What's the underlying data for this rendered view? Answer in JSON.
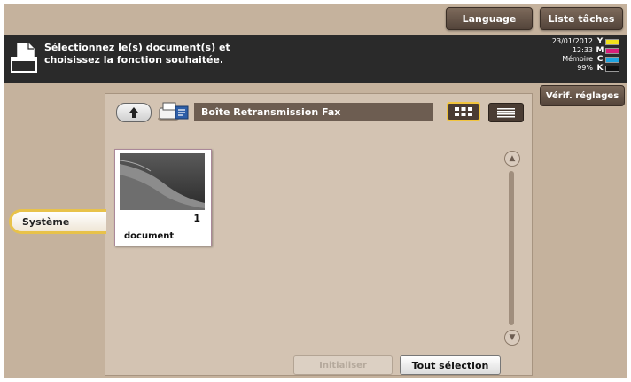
{
  "header": {
    "language_label": "Language",
    "tasks_label": "Liste tâches"
  },
  "message": {
    "line1": "Sélectionnez le(s) document(s) et",
    "line2": "choisissez la fonction souhaitée."
  },
  "status": {
    "date": "23/01/2012",
    "time": "12:33",
    "memory_label": "Mémoire",
    "memory_value": "99%",
    "toner": [
      {
        "letter": "Y",
        "color": "#f2e21c"
      },
      {
        "letter": "M",
        "color": "#d81e7a"
      },
      {
        "letter": "C",
        "color": "#1ea3e0"
      },
      {
        "letter": "K",
        "color": "#111111"
      }
    ]
  },
  "verif_label": "Vérif. réglages",
  "box": {
    "title": "Boîte Retransmission Fax"
  },
  "document": {
    "count": "1",
    "name": "document"
  },
  "buttons": {
    "reinit": "Initialiser",
    "select_all": "Tout sélection"
  },
  "sidebar": {
    "systeme": "Système"
  },
  "colors": {
    "accent": "#e8c24a",
    "panel": "#d3c3b2",
    "background": "#c5b29d"
  }
}
